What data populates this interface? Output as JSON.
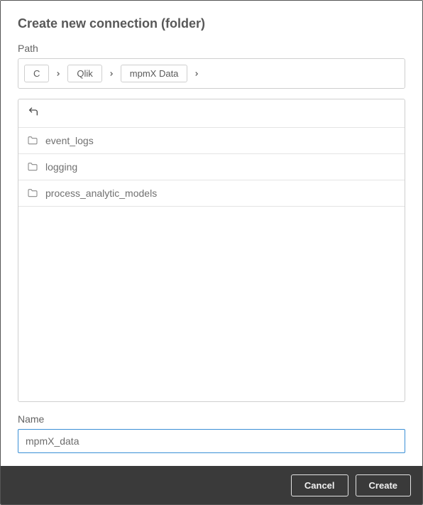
{
  "dialog": {
    "title": "Create new connection (folder)",
    "path_label": "Path",
    "name_label": "Name",
    "name_value": "mpmX_data"
  },
  "breadcrumb": {
    "items": [
      {
        "label": "C"
      },
      {
        "label": "Qlik"
      },
      {
        "label": "mpmX Data"
      }
    ]
  },
  "folders": [
    {
      "name": "event_logs"
    },
    {
      "name": "logging"
    },
    {
      "name": "process_analytic_models"
    }
  ],
  "footer": {
    "cancel_label": "Cancel",
    "create_label": "Create"
  }
}
